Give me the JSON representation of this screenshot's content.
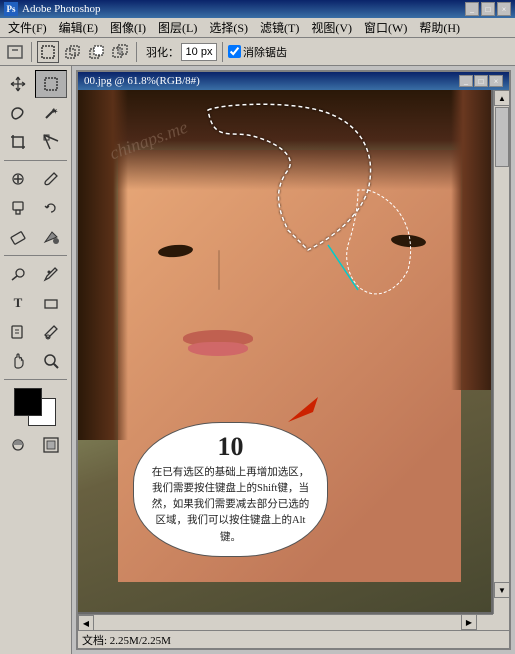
{
  "app": {
    "title": "Adobe Photoshop",
    "icon": "PS"
  },
  "title_bar": {
    "title": "Adobe Photoshop",
    "minimize_label": "_",
    "maximize_label": "□",
    "close_label": "×"
  },
  "menu": {
    "items": [
      {
        "label": "文件(F)"
      },
      {
        "label": "编辑(E)"
      },
      {
        "label": "图像(I)"
      },
      {
        "label": "图层(L)"
      },
      {
        "label": "选择(S)"
      },
      {
        "label": "滤镜(T)"
      },
      {
        "label": "视图(V)"
      },
      {
        "label": "窗口(W)"
      },
      {
        "label": "帮助(H)"
      }
    ]
  },
  "toolbar": {
    "feather_label": "羽化：",
    "feather_value": "10 px",
    "antialias_label": "消除锯齿",
    "antialias_checked": true
  },
  "document": {
    "title": "00.jpg @ 61.8%(RGB/8#)",
    "minimize": "_",
    "maximize": "□",
    "close": "×"
  },
  "tools": [
    {
      "name": "move",
      "icon": "✛",
      "row": 0
    },
    {
      "name": "marquee-rect",
      "icon": "⬚",
      "row": 0
    },
    {
      "name": "lasso",
      "icon": "⌓",
      "row": 1
    },
    {
      "name": "magic-wand",
      "icon": "✦",
      "row": 1
    },
    {
      "name": "crop",
      "icon": "⌗",
      "row": 2
    },
    {
      "name": "slice",
      "icon": "⊘",
      "row": 2
    },
    {
      "name": "heal",
      "icon": "✚",
      "row": 3
    },
    {
      "name": "brush",
      "icon": "✏",
      "row": 3
    },
    {
      "name": "stamp",
      "icon": "⎘",
      "row": 4
    },
    {
      "name": "history-brush",
      "icon": "↺",
      "row": 4
    },
    {
      "name": "eraser",
      "icon": "◻",
      "row": 5
    },
    {
      "name": "fill",
      "icon": "▣",
      "row": 5
    },
    {
      "name": "dodge",
      "icon": "◑",
      "row": 6
    },
    {
      "name": "pen",
      "icon": "✒",
      "row": 6
    },
    {
      "name": "text",
      "icon": "T",
      "row": 7
    },
    {
      "name": "shape",
      "icon": "▭",
      "row": 7
    },
    {
      "name": "notes",
      "icon": "✉",
      "row": 8
    },
    {
      "name": "eyedrop",
      "icon": "✎",
      "row": 8
    },
    {
      "name": "hand",
      "icon": "✋",
      "row": 9
    },
    {
      "name": "zoom",
      "icon": "🔍",
      "row": 9
    }
  ],
  "callout": {
    "number": "10",
    "text": "在已有选区的基础上再增加选区，我们需要按住键盘上的Shift键，当然，如果我们需要减去部分已选的区域，我们可以按住键盘上的Alt键。"
  },
  "watermark": "chinaps.me",
  "status": {
    "text": "文档: 2.25M/2.25M"
  }
}
